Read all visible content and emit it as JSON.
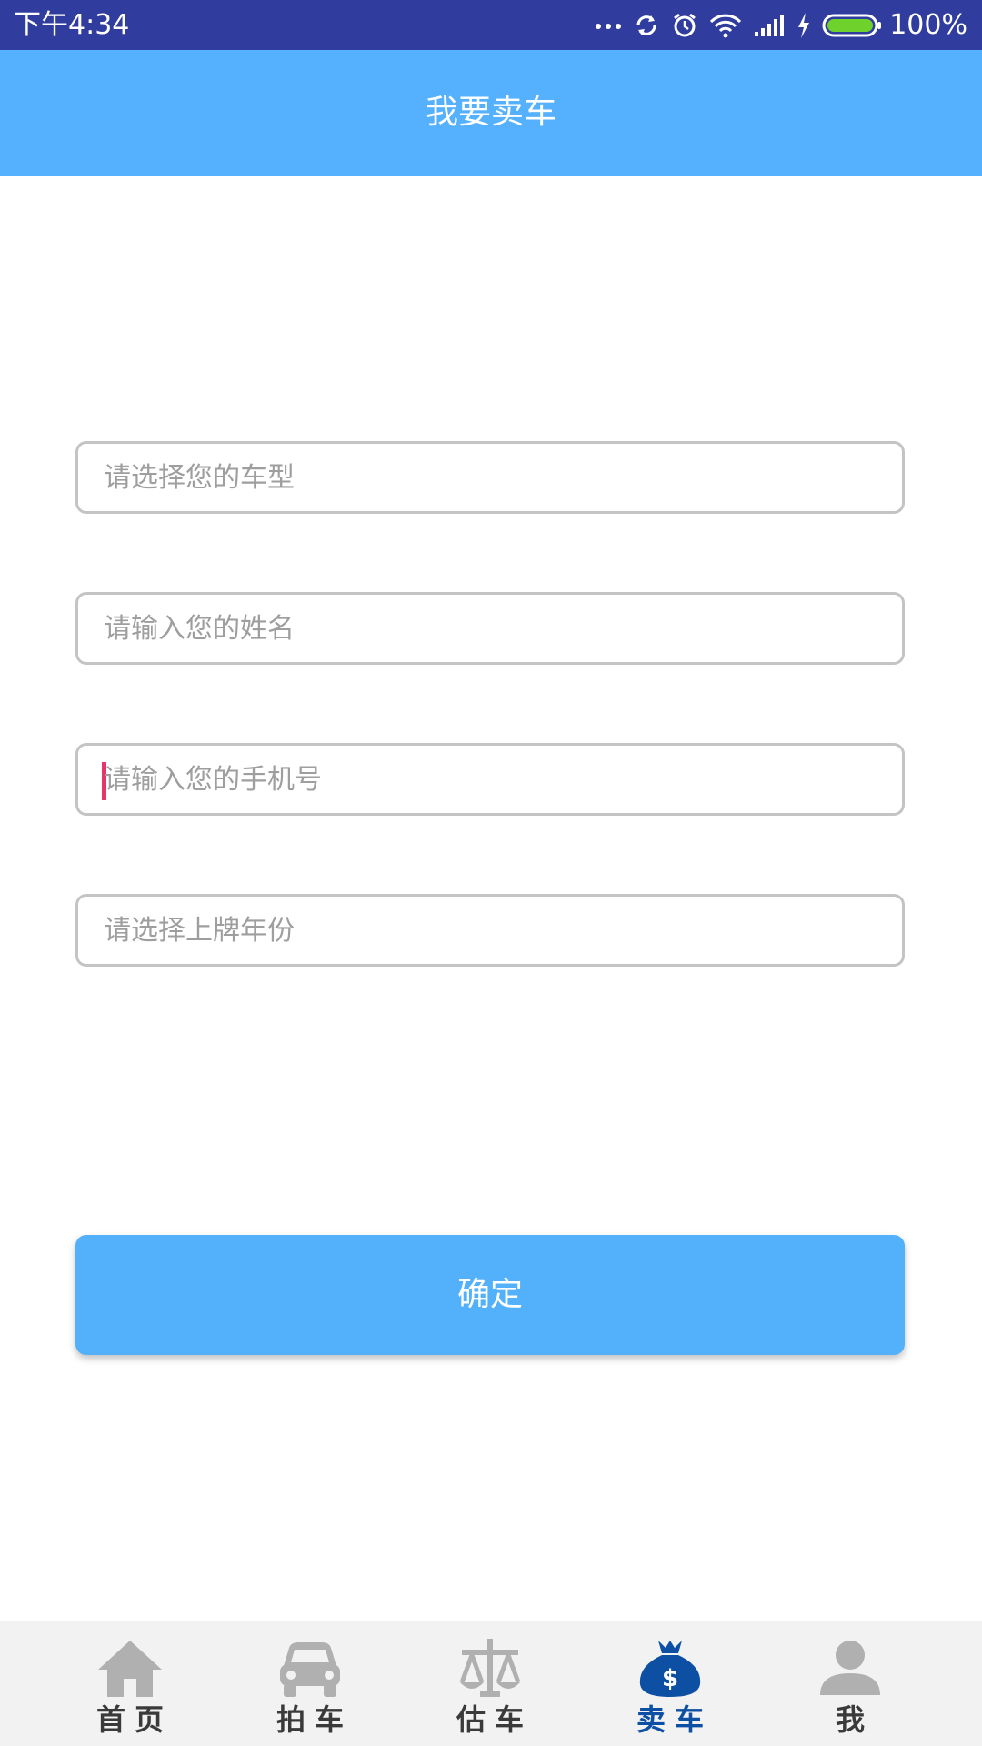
{
  "status_bar": {
    "time": "下午4:34",
    "battery_text": "100%",
    "icons": [
      "more-dots-icon",
      "sync-icon",
      "alarm-icon",
      "wifi-icon",
      "signal-icon",
      "charging-icon",
      "battery-icon"
    ]
  },
  "header": {
    "title": "我要卖车"
  },
  "form": {
    "car_model_placeholder": "请选择您的车型",
    "name_placeholder": "请输入您的姓名",
    "phone_placeholder": "请输入您的手机号",
    "year_placeholder": "请选择上牌年份",
    "confirm_label": "确定"
  },
  "bottom_nav": {
    "items": [
      {
        "label": "首页",
        "icon": "home-icon",
        "active": false
      },
      {
        "label": "拍车",
        "icon": "car-icon",
        "active": false
      },
      {
        "label": "估车",
        "icon": "scale-icon",
        "active": false
      },
      {
        "label": "卖车",
        "icon": "money-bag-icon",
        "active": true
      },
      {
        "label": "我",
        "icon": "person-icon",
        "active": false
      }
    ]
  },
  "colors": {
    "status_bar": "#303d9f",
    "header": "#55b1fd",
    "button": "#53b0fb",
    "nav_active": "#0d4fa3",
    "nav_inactive": "#b0b0b0",
    "cursor": "#e8336c"
  }
}
